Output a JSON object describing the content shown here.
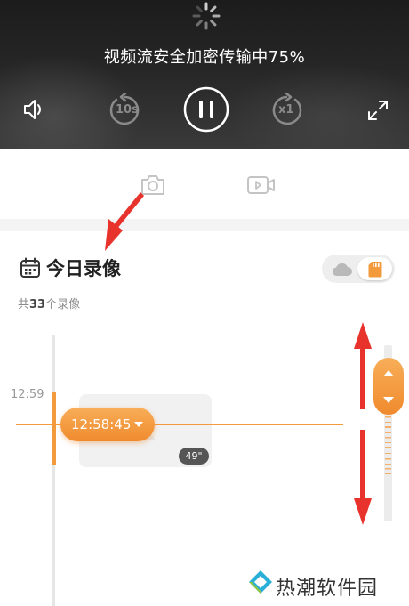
{
  "player": {
    "status_text": "视频流安全加密传输中75%",
    "progress_percent": 75,
    "rewind_label": "10s",
    "speed_label": "x1",
    "icons": [
      "loading-spinner-icon",
      "volume-icon",
      "rewind-10s-icon",
      "pause-icon",
      "speed-icon",
      "fullscreen-icon"
    ]
  },
  "toolbar": {
    "icons": [
      "camera-icon",
      "video-record-icon"
    ]
  },
  "recordings": {
    "title": "今日录像",
    "count_prefix": "共",
    "count": "33",
    "count_suffix": "个录像",
    "storage_toggle": {
      "options": [
        "cloud-icon",
        "sd-card-icon"
      ],
      "selected": "sd-card-icon"
    }
  },
  "timeline": {
    "hour_label": "12:59",
    "cursor_time": "12:58:45",
    "clip_duration": "49\""
  },
  "watermark": {
    "text": "热潮软件园"
  },
  "colors": {
    "accent": "#f39a3c",
    "annotation_arrow": "#e8322c",
    "video_bg": "#222222"
  }
}
